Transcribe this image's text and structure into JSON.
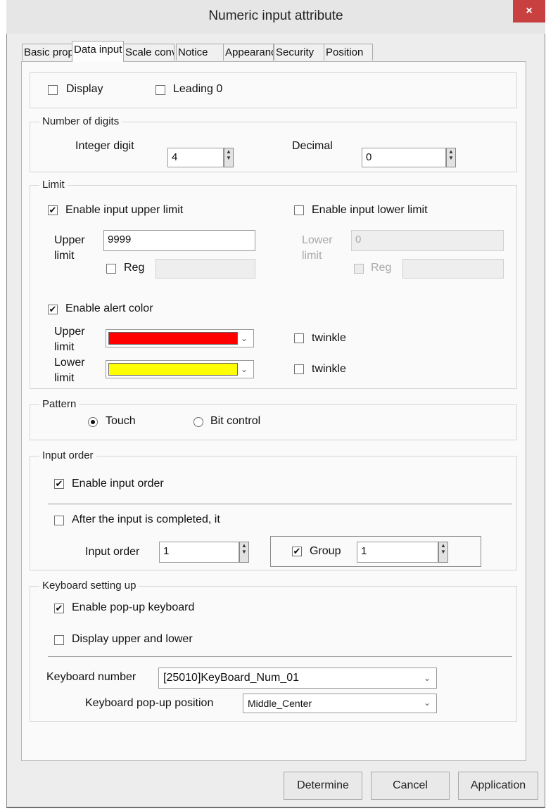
{
  "window": {
    "title": "Numeric input attribute",
    "close_glyph": "×"
  },
  "tabs": [
    {
      "label": "Basic properties"
    },
    {
      "label": "Data input"
    },
    {
      "label": "Scale conversion"
    },
    {
      "label": "Notice"
    },
    {
      "label": "Appearance"
    },
    {
      "label": "Security"
    },
    {
      "label": "Position"
    }
  ],
  "display_section": {
    "display_label": "Display",
    "leading0_label": "Leading 0"
  },
  "digits": {
    "title": "Number of digits",
    "integer_label": "Integer digit",
    "integer_value": "4",
    "decimal_label": "Decimal",
    "decimal_value": "0"
  },
  "limit": {
    "title": "Limit",
    "enable_upper_label": "Enable input upper limit",
    "enable_lower_label": "Enable input lower limit",
    "upper_label_1": "Upper",
    "upper_label_2": "limit",
    "upper_value": "9999",
    "lower_label_1": "Lower",
    "lower_label_2": "limit",
    "lower_value": "0",
    "reg_label": "Reg",
    "reg_label_lower": "Reg",
    "alert_label": "Enable alert color",
    "alert_upper_1": "Upper",
    "alert_upper_2": "limit",
    "alert_lower_1": "Lower",
    "alert_lower_2": "limit",
    "upper_color": "#ff0000",
    "lower_color": "#ffff00",
    "twinkle_label_1": "twinkle",
    "twinkle_label_2": "twinkle"
  },
  "pattern": {
    "title": "Pattern",
    "touch_label": "Touch",
    "bit_label": "Bit control",
    "selected": "Touch"
  },
  "input_order": {
    "title": "Input order",
    "enable_label": "Enable input order",
    "after_label": "After the input is completed, it",
    "order_label": "Input order",
    "order_value": "1",
    "group_label": "Group",
    "group_value": "1"
  },
  "keyboard": {
    "title": "Keyboard setting up",
    "popup_label": "Enable pop-up keyboard",
    "upper_lower_label": "Display upper and lower",
    "number_label": "Keyboard number",
    "number_value": "[25010]KeyBoard_Num_01",
    "position_label": "Keyboard pop-up position",
    "position_value": "Middle_Center"
  },
  "buttons": {
    "determine": "Determine",
    "cancel": "Cancel",
    "application": "Application"
  },
  "icons": {
    "check": "✔",
    "spin_up": "▲",
    "spin_down": "▼",
    "dropdown": "⌄"
  }
}
